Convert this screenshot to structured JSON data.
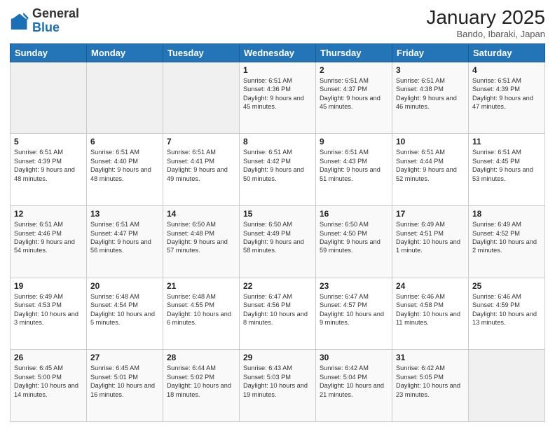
{
  "logo": {
    "general": "General",
    "blue": "Blue"
  },
  "header": {
    "month": "January 2025",
    "location": "Bando, Ibaraki, Japan"
  },
  "days_of_week": [
    "Sunday",
    "Monday",
    "Tuesday",
    "Wednesday",
    "Thursday",
    "Friday",
    "Saturday"
  ],
  "weeks": [
    [
      {
        "day": "",
        "info": ""
      },
      {
        "day": "",
        "info": ""
      },
      {
        "day": "",
        "info": ""
      },
      {
        "day": "1",
        "info": "Sunrise: 6:51 AM\nSunset: 4:36 PM\nDaylight: 9 hours and 45 minutes."
      },
      {
        "day": "2",
        "info": "Sunrise: 6:51 AM\nSunset: 4:37 PM\nDaylight: 9 hours and 45 minutes."
      },
      {
        "day": "3",
        "info": "Sunrise: 6:51 AM\nSunset: 4:38 PM\nDaylight: 9 hours and 46 minutes."
      },
      {
        "day": "4",
        "info": "Sunrise: 6:51 AM\nSunset: 4:39 PM\nDaylight: 9 hours and 47 minutes."
      }
    ],
    [
      {
        "day": "5",
        "info": "Sunrise: 6:51 AM\nSunset: 4:39 PM\nDaylight: 9 hours and 48 minutes."
      },
      {
        "day": "6",
        "info": "Sunrise: 6:51 AM\nSunset: 4:40 PM\nDaylight: 9 hours and 48 minutes."
      },
      {
        "day": "7",
        "info": "Sunrise: 6:51 AM\nSunset: 4:41 PM\nDaylight: 9 hours and 49 minutes."
      },
      {
        "day": "8",
        "info": "Sunrise: 6:51 AM\nSunset: 4:42 PM\nDaylight: 9 hours and 50 minutes."
      },
      {
        "day": "9",
        "info": "Sunrise: 6:51 AM\nSunset: 4:43 PM\nDaylight: 9 hours and 51 minutes."
      },
      {
        "day": "10",
        "info": "Sunrise: 6:51 AM\nSunset: 4:44 PM\nDaylight: 9 hours and 52 minutes."
      },
      {
        "day": "11",
        "info": "Sunrise: 6:51 AM\nSunset: 4:45 PM\nDaylight: 9 hours and 53 minutes."
      }
    ],
    [
      {
        "day": "12",
        "info": "Sunrise: 6:51 AM\nSunset: 4:46 PM\nDaylight: 9 hours and 54 minutes."
      },
      {
        "day": "13",
        "info": "Sunrise: 6:51 AM\nSunset: 4:47 PM\nDaylight: 9 hours and 56 minutes."
      },
      {
        "day": "14",
        "info": "Sunrise: 6:50 AM\nSunset: 4:48 PM\nDaylight: 9 hours and 57 minutes."
      },
      {
        "day": "15",
        "info": "Sunrise: 6:50 AM\nSunset: 4:49 PM\nDaylight: 9 hours and 58 minutes."
      },
      {
        "day": "16",
        "info": "Sunrise: 6:50 AM\nSunset: 4:50 PM\nDaylight: 9 hours and 59 minutes."
      },
      {
        "day": "17",
        "info": "Sunrise: 6:49 AM\nSunset: 4:51 PM\nDaylight: 10 hours and 1 minute."
      },
      {
        "day": "18",
        "info": "Sunrise: 6:49 AM\nSunset: 4:52 PM\nDaylight: 10 hours and 2 minutes."
      }
    ],
    [
      {
        "day": "19",
        "info": "Sunrise: 6:49 AM\nSunset: 4:53 PM\nDaylight: 10 hours and 3 minutes."
      },
      {
        "day": "20",
        "info": "Sunrise: 6:48 AM\nSunset: 4:54 PM\nDaylight: 10 hours and 5 minutes."
      },
      {
        "day": "21",
        "info": "Sunrise: 6:48 AM\nSunset: 4:55 PM\nDaylight: 10 hours and 6 minutes."
      },
      {
        "day": "22",
        "info": "Sunrise: 6:47 AM\nSunset: 4:56 PM\nDaylight: 10 hours and 8 minutes."
      },
      {
        "day": "23",
        "info": "Sunrise: 6:47 AM\nSunset: 4:57 PM\nDaylight: 10 hours and 9 minutes."
      },
      {
        "day": "24",
        "info": "Sunrise: 6:46 AM\nSunset: 4:58 PM\nDaylight: 10 hours and 11 minutes."
      },
      {
        "day": "25",
        "info": "Sunrise: 6:46 AM\nSunset: 4:59 PM\nDaylight: 10 hours and 13 minutes."
      }
    ],
    [
      {
        "day": "26",
        "info": "Sunrise: 6:45 AM\nSunset: 5:00 PM\nDaylight: 10 hours and 14 minutes."
      },
      {
        "day": "27",
        "info": "Sunrise: 6:45 AM\nSunset: 5:01 PM\nDaylight: 10 hours and 16 minutes."
      },
      {
        "day": "28",
        "info": "Sunrise: 6:44 AM\nSunset: 5:02 PM\nDaylight: 10 hours and 18 minutes."
      },
      {
        "day": "29",
        "info": "Sunrise: 6:43 AM\nSunset: 5:03 PM\nDaylight: 10 hours and 19 minutes."
      },
      {
        "day": "30",
        "info": "Sunrise: 6:42 AM\nSunset: 5:04 PM\nDaylight: 10 hours and 21 minutes."
      },
      {
        "day": "31",
        "info": "Sunrise: 6:42 AM\nSunset: 5:05 PM\nDaylight: 10 hours and 23 minutes."
      },
      {
        "day": "",
        "info": ""
      }
    ]
  ]
}
